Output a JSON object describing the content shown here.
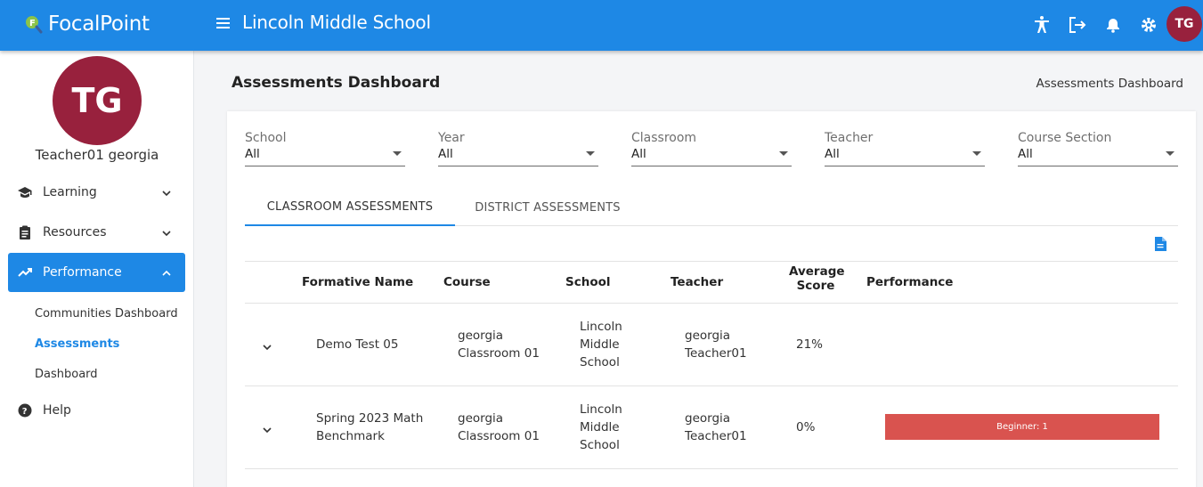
{
  "app": {
    "brand": "FocalPoint",
    "school_title": "Lincoln Middle School",
    "user_initials": "TG"
  },
  "colors": {
    "primary": "#1e88e5",
    "avatar": "#98213d",
    "beginner": "#d9534f"
  },
  "topbar": {
    "icons": [
      "accessibility-icon",
      "logout-icon",
      "bell-icon",
      "gear-icon"
    ]
  },
  "sidebar": {
    "user_name": "Teacher01 georgia",
    "items": [
      {
        "label": "Learning",
        "icon": "graduation-cap-icon"
      },
      {
        "label": "Resources",
        "icon": "clipboard-icon"
      },
      {
        "label": "Performance",
        "icon": "trending-up-icon"
      }
    ],
    "sub_items": [
      {
        "label": "Communities Dashboard"
      },
      {
        "label": "Assessments"
      },
      {
        "label": "Dashboard"
      }
    ],
    "help": "Help"
  },
  "main": {
    "title": "Assessments Dashboard",
    "breadcrumb": "Assessments Dashboard",
    "filters": [
      {
        "label": "School",
        "value": "All"
      },
      {
        "label": "Year",
        "value": "All"
      },
      {
        "label": "Classroom",
        "value": "All"
      },
      {
        "label": "Teacher",
        "value": "All"
      },
      {
        "label": "Course Section",
        "value": "All"
      }
    ],
    "tabs": [
      {
        "label": "CLASSROOM ASSESSMENTS"
      },
      {
        "label": "DISTRICT ASSESSMENTS"
      }
    ],
    "table": {
      "headers": {
        "name": "Formative Name",
        "course": "Course",
        "school": "School",
        "teacher": "Teacher",
        "avg_line1": "Average",
        "avg_line2": "Score",
        "performance": "Performance"
      },
      "rows": [
        {
          "name_l1": "Demo Test 05",
          "name_l2": "",
          "course_l1": "georgia",
          "course_l2": "Classroom 01",
          "school_l1": "Lincoln",
          "school_l2": "Middle",
          "school_l3": "School",
          "teacher_l1": "georgia",
          "teacher_l2": "Teacher01",
          "avg": "21%",
          "performance": ""
        },
        {
          "name_l1": "Spring 2023 Math",
          "name_l2": "Benchmark",
          "course_l1": "georgia",
          "course_l2": "Classroom 01",
          "school_l1": "Lincoln",
          "school_l2": "Middle",
          "school_l3": "School",
          "teacher_l1": "georgia",
          "teacher_l2": "Teacher01",
          "avg": "0%",
          "performance": "Beginner: 1"
        }
      ]
    }
  }
}
